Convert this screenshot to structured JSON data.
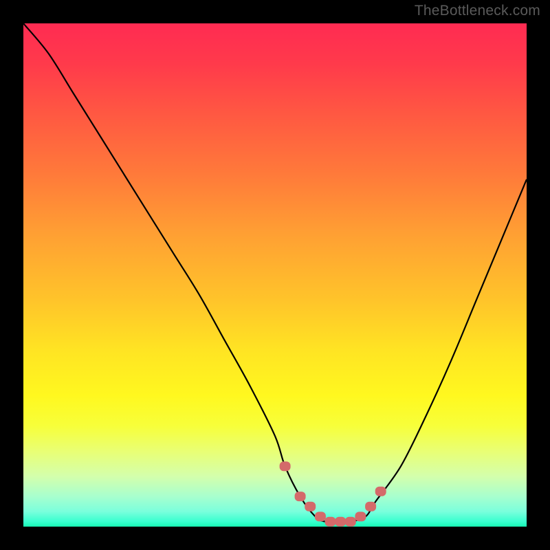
{
  "watermark": "TheBottleneck.com",
  "chart_data": {
    "type": "line",
    "title": "",
    "xlabel": "",
    "ylabel": "",
    "xlim": [
      0,
      100
    ],
    "ylim": [
      0,
      100
    ],
    "series": [
      {
        "name": "bottleneck-curve",
        "x": [
          0,
          5,
          10,
          15,
          20,
          25,
          30,
          35,
          40,
          45,
          50,
          52,
          55,
          58,
          60,
          63,
          65,
          68,
          70,
          75,
          80,
          85,
          90,
          95,
          100
        ],
        "values": [
          100,
          94,
          86,
          78,
          70,
          62,
          54,
          46,
          37,
          28,
          18,
          12,
          6,
          2,
          1,
          1,
          1,
          2,
          5,
          12,
          22,
          33,
          45,
          57,
          69
        ]
      }
    ],
    "markers": {
      "name": "highlight-points",
      "x": [
        52,
        55,
        57,
        59,
        61,
        63,
        65,
        67,
        69,
        71
      ],
      "values": [
        12,
        6,
        4,
        2,
        1,
        1,
        1,
        2,
        4,
        7
      ]
    },
    "gradient_stops": [
      {
        "pos": 0.0,
        "color": "#ff2b52"
      },
      {
        "pos": 0.18,
        "color": "#ff5842"
      },
      {
        "pos": 0.42,
        "color": "#ffa033"
      },
      {
        "pos": 0.65,
        "color": "#ffe423"
      },
      {
        "pos": 0.85,
        "color": "#e9ff74"
      },
      {
        "pos": 0.97,
        "color": "#7affdc"
      },
      {
        "pos": 1.0,
        "color": "#18f7b4"
      }
    ],
    "curve_color": "#000000",
    "marker_color": "#d46a6a"
  }
}
